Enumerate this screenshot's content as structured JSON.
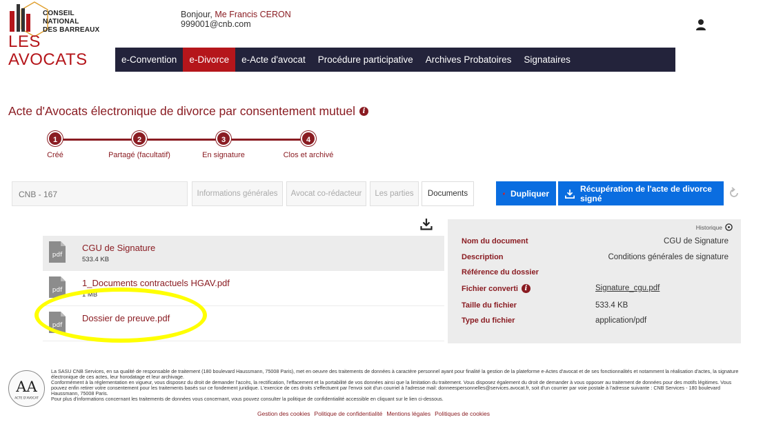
{
  "brand": {
    "org_line1": "CONSEIL NATIONAL",
    "org_line2": "DES BARREAUX",
    "name": "LES AVOCATS"
  },
  "user": {
    "greeting": "Bonjour,",
    "name": "Me Francis CERON",
    "email": "999001@cnb.com"
  },
  "nav": [
    {
      "label": "e-Convention"
    },
    {
      "label": "e-Divorce"
    },
    {
      "label": "e-Acte d'avocat"
    },
    {
      "label": "Procédure participative"
    },
    {
      "label": "Archives Probatoires"
    },
    {
      "label": "Signataires"
    }
  ],
  "page_title": "Acte d'Avocats électronique de divorce par consentement mutuel",
  "steps": [
    {
      "num": "1",
      "label": "Créé"
    },
    {
      "num": "2",
      "label": "Partagé (facultatif)"
    },
    {
      "num": "3",
      "label": "En signature"
    },
    {
      "num": "4",
      "label": "Clos et archivé"
    }
  ],
  "reference": "CNB - 167",
  "tabs": [
    {
      "label": "Informations générales"
    },
    {
      "label": "Avocat co-rédacteur"
    },
    {
      "label": "Les parties"
    },
    {
      "label": "Documents"
    }
  ],
  "buttons": {
    "duplicate": "Dupliquer",
    "recover": "Récupération de l'acte de divorce signé"
  },
  "documents": [
    {
      "icon_label": "pdf",
      "name": "CGU de Signature",
      "size": "533.4 KB"
    },
    {
      "icon_label": "pdf",
      "name": "1_Documents contractuels HGAV.pdf",
      "size": "1 MB"
    },
    {
      "icon_label": "pdf",
      "name": "Dossier de preuve.pdf",
      "size": ""
    }
  ],
  "details": {
    "history": "Historique",
    "rows": [
      {
        "label": "Nom du document",
        "value": "CGU de Signature"
      },
      {
        "label": "Description",
        "value": "Conditions générales de signature"
      },
      {
        "label": "Référence du dossier",
        "value": ""
      },
      {
        "label": "Fichier converti",
        "value": "Signature_cgu.pdf"
      },
      {
        "label": "Taille du fichier",
        "value": "533.4 KB"
      },
      {
        "label": "Type du fichier",
        "value": "application/pdf"
      }
    ]
  },
  "footer": {
    "logo_text": "ACTE D'AVOCAT",
    "paragraph1": "La SASU CNB Services, en sa qualité de responsable de traitement (180 boulevard Haussmann, 75008 Paris), met en oeuvre des traitements de données à caractère personnel ayant pour finalité la gestion de la plateforme e-Actes d'avocat et de ses fonctionnalités et notamment la réalisation d'actes, la signature électronique de ces actes, leur horodatage et leur archivage.",
    "paragraph2": "Conformément à la réglementation en vigueur, vous disposez du droit de demander l'accès, la rectification, l'effacement et la portabilité de vos données ainsi que la limitation du traitement. Vous disposez également du droit de demander à vous opposer au traitement de données pour des motifs légitimes. Vous pouvez enfin retirer votre consentement pour les traitements basés sur ce fondement juridique. L'exercice de ces droits s'effectuent par l'envoi soit d'un courriel à l'adresse mail: donneespersonnelles@services.avocat.fr, soit d'un courrier par voie postale à l'adresse suivante : CNB Services - 180 boulevard Haussmann, 75008 Paris.",
    "paragraph3": "Pour plus d'informations concernant les traitements de données vous concernant, vous pouvez consulter la politique de confidentialité accessible en cliquant sur le lien ci-dessous.",
    "links": [
      "Gestion des cookies",
      "Politique de confidentialité",
      "Mentions légales",
      "Politiques de cookies"
    ]
  },
  "colors": {
    "brand_red": "#b5161b",
    "dark_red": "#8a1c22",
    "nav_bg": "#23233b",
    "action_blue": "#0a6de0",
    "highlight": "#ffff00"
  }
}
